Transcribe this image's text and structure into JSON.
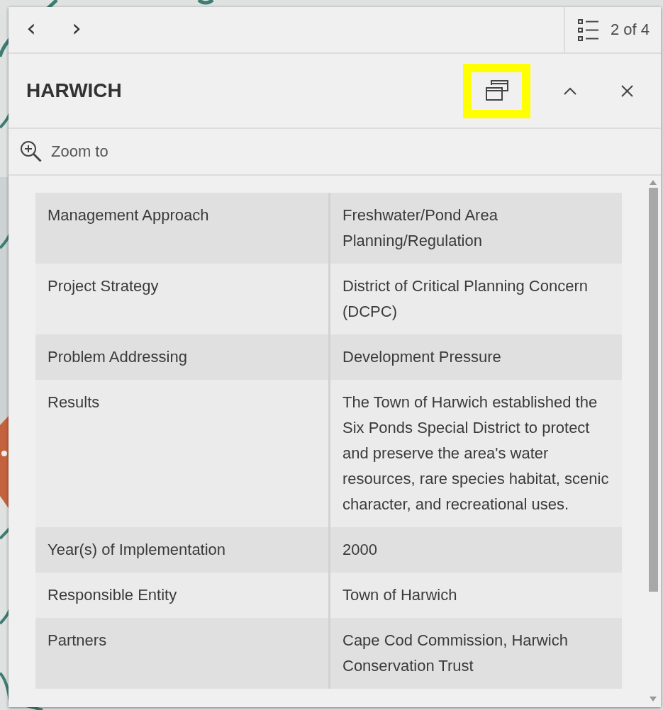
{
  "navigation": {
    "previous": "‹",
    "next": "›",
    "pagination": "2 of 4"
  },
  "header": {
    "title": "HARWICH",
    "dock_button": {
      "highlighted": true
    }
  },
  "actions": [
    {
      "label": "Zoom to"
    }
  ],
  "table": {
    "rows": [
      {
        "field": "Management Approach",
        "value": "Freshwater/Pond Area Planning/Regulation"
      },
      {
        "field": "Project Strategy",
        "value": "District of Critical Planning Concern (DCPC)"
      },
      {
        "field": "Problem Addressing",
        "value": "Development Pressure"
      },
      {
        "field": "Results",
        "value": "The Town of Harwich established the Six Ponds Special District to protect and preserve the area's water resources, rare species habitat, scenic character, and recreational uses."
      },
      {
        "field": "Year(s) of Implementation",
        "value": "2000"
      },
      {
        "field": "Responsible Entity",
        "value": "Town of Harwich"
      },
      {
        "field": "Partners",
        "value": "Cape Cod Commission, Harwich Conservation Trust"
      }
    ]
  }
}
